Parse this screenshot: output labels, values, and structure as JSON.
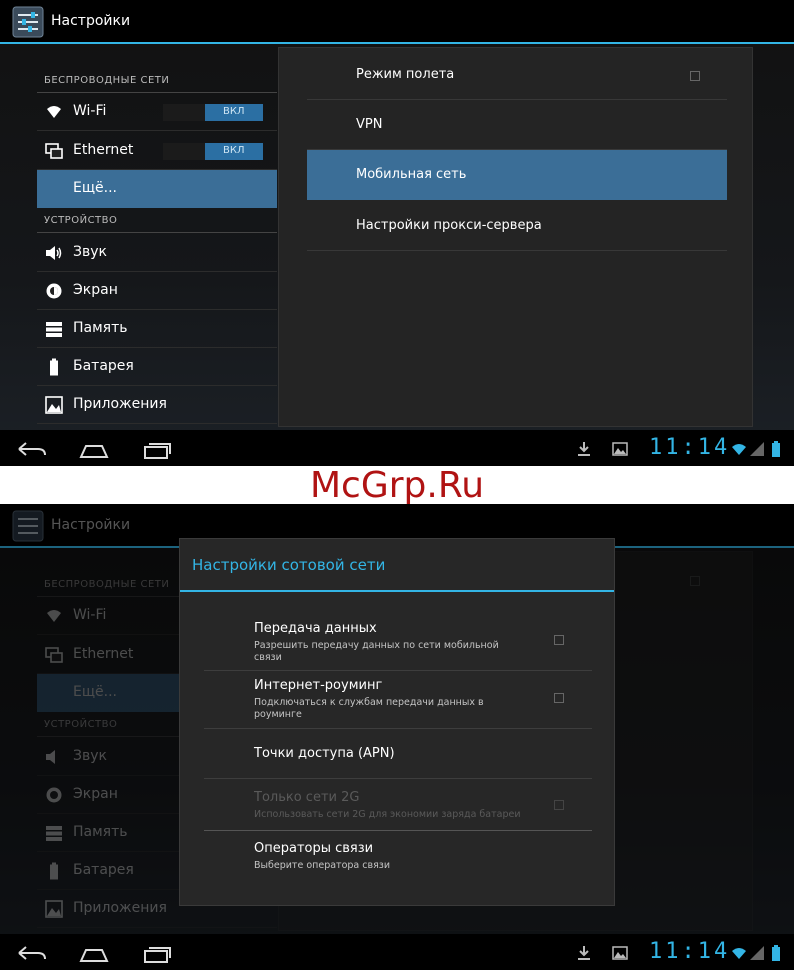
{
  "app": {
    "title": "Настройки"
  },
  "sidebar": {
    "wireless_header": "БЕСПРОВОДНЫЕ СЕТИ",
    "device_header": "УСТРОЙСТВО",
    "items": [
      {
        "label": "Wi-Fi",
        "toggle": "ВКЛ"
      },
      {
        "label": "Ethernet",
        "toggle": "ВКЛ"
      },
      {
        "label": "Ещё..."
      },
      {
        "label": "Звук"
      },
      {
        "label": "Экран"
      },
      {
        "label": "Память"
      },
      {
        "label": "Батарея"
      },
      {
        "label": "Приложения"
      }
    ]
  },
  "detail": {
    "items": [
      {
        "label": "Режим полета",
        "checked": false
      },
      {
        "label": "VPN"
      },
      {
        "label": "Мобильная сеть",
        "selected": true
      },
      {
        "label": "Настройки прокси-сервера"
      }
    ]
  },
  "status": {
    "time": "11:14",
    "accent": "#33b5e5",
    "selection": "#3b6e97"
  },
  "watermark": "McGrp.Ru",
  "dialog": {
    "title": "Настройки сотовой сети",
    "items": [
      {
        "title": "Передача данных",
        "summary": "Разрешить передачу данных по сети мобильной связи",
        "checkbox": true,
        "enabled": true
      },
      {
        "title": "Интернет-роуминг",
        "summary": "Подключаться к службам передачи данных в роуминге",
        "checkbox": true,
        "enabled": true
      },
      {
        "title": "Точки доступа (APN)",
        "enabled": true
      },
      {
        "title": "Только сети 2G",
        "summary": "Использовать сети 2G для экономии заряда батареи",
        "checkbox": true,
        "enabled": false
      },
      {
        "title": "Операторы связи",
        "summary": "Выберите оператора связи",
        "enabled": true
      }
    ]
  },
  "icons": {
    "app": "settings-sliders-icon",
    "wifi": "wifi-icon",
    "ethernet": "ethernet-icon",
    "sound": "speaker-icon",
    "display": "brightness-icon",
    "storage": "storage-icon",
    "battery": "battery-icon",
    "apps": "apps-icon",
    "back": "back-icon",
    "home": "home-icon",
    "recents": "recents-icon",
    "download": "download-icon",
    "gallery": "gallery-icon",
    "signal": "signal-icon"
  }
}
